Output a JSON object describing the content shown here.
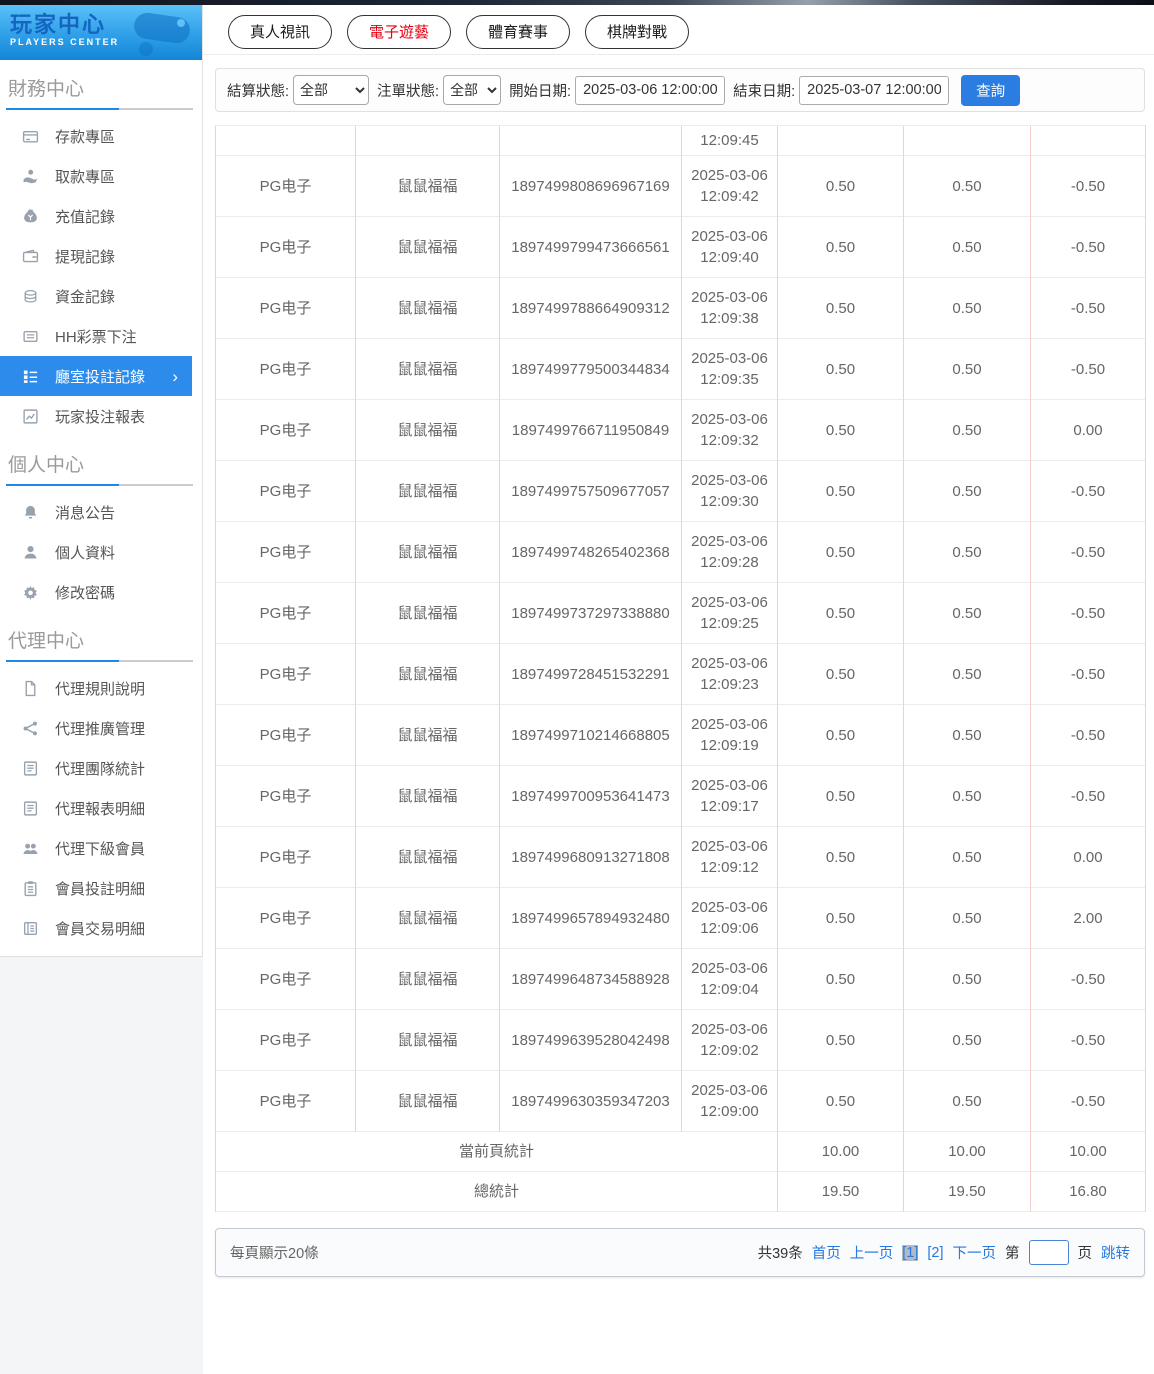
{
  "logo": {
    "title": "玩家中心",
    "subtitle": "PLAYERS  CENTER"
  },
  "sidebar": {
    "sections": [
      {
        "title": "財務中心",
        "items": [
          {
            "icon": "card",
            "label": "存款專區",
            "active": false
          },
          {
            "icon": "hand",
            "label": "取款專區",
            "active": false
          },
          {
            "icon": "moneybag",
            "label": "充值記錄",
            "active": false
          },
          {
            "icon": "wallet",
            "label": "提現記錄",
            "active": false
          },
          {
            "icon": "coins",
            "label": "資金記錄",
            "active": false
          },
          {
            "icon": "ticket",
            "label": "HH彩票下注",
            "active": false
          },
          {
            "icon": "rooms",
            "label": "廳室投註記錄",
            "active": true
          },
          {
            "icon": "chart",
            "label": "玩家投注報表",
            "active": false
          }
        ]
      },
      {
        "title": "個人中心",
        "items": [
          {
            "icon": "bell",
            "label": "消息公告",
            "active": false
          },
          {
            "icon": "user",
            "label": "個人資料",
            "active": false
          },
          {
            "icon": "gear",
            "label": "修改密碼",
            "active": false
          }
        ]
      },
      {
        "title": "代理中心",
        "items": [
          {
            "icon": "doc",
            "label": "代理規則說明",
            "active": false
          },
          {
            "icon": "share",
            "label": "代理推廣管理",
            "active": false
          },
          {
            "icon": "report",
            "label": "代理團隊統計",
            "active": false
          },
          {
            "icon": "report",
            "label": "代理報表明細",
            "active": false
          },
          {
            "icon": "users",
            "label": "代理下級會員",
            "active": false
          },
          {
            "icon": "clipboard",
            "label": "會員投註明細",
            "active": false
          },
          {
            "icon": "translist",
            "label": "會員交易明細",
            "active": false
          }
        ]
      }
    ]
  },
  "tabs": [
    {
      "label": "真人視訊",
      "active": false
    },
    {
      "label": "電子遊藝",
      "active": true
    },
    {
      "label": "體育賽事",
      "active": false
    },
    {
      "label": "棋牌對戰",
      "active": false
    }
  ],
  "filters": {
    "settle_label": "結算狀態:",
    "settle_value": "全部",
    "order_label": "注單狀態:",
    "order_value": "全部",
    "start_label": "開始日期:",
    "start_value": "2025-03-06 12:00:00",
    "end_label": "結束日期:",
    "end_value": "2025-03-07 12:00:00",
    "search_label": "查詢"
  },
  "table": {
    "partial_row_time": "12:09:45",
    "rows": [
      {
        "provider": "PG电子",
        "game": "鼠鼠福福",
        "order_id": "1897499808696967169",
        "date": "2025-03-06",
        "time": "12:09:42",
        "bet": "0.50",
        "valid_bet": "0.50",
        "profit": "-0.50"
      },
      {
        "provider": "PG电子",
        "game": "鼠鼠福福",
        "order_id": "1897499799473666561",
        "date": "2025-03-06",
        "time": "12:09:40",
        "bet": "0.50",
        "valid_bet": "0.50",
        "profit": "-0.50"
      },
      {
        "provider": "PG电子",
        "game": "鼠鼠福福",
        "order_id": "1897499788664909312",
        "date": "2025-03-06",
        "time": "12:09:38",
        "bet": "0.50",
        "valid_bet": "0.50",
        "profit": "-0.50"
      },
      {
        "provider": "PG电子",
        "game": "鼠鼠福福",
        "order_id": "1897499779500344834",
        "date": "2025-03-06",
        "time": "12:09:35",
        "bet": "0.50",
        "valid_bet": "0.50",
        "profit": "-0.50"
      },
      {
        "provider": "PG电子",
        "game": "鼠鼠福福",
        "order_id": "1897499766711950849",
        "date": "2025-03-06",
        "time": "12:09:32",
        "bet": "0.50",
        "valid_bet": "0.50",
        "profit": "0.00"
      },
      {
        "provider": "PG电子",
        "game": "鼠鼠福福",
        "order_id": "1897499757509677057",
        "date": "2025-03-06",
        "time": "12:09:30",
        "bet": "0.50",
        "valid_bet": "0.50",
        "profit": "-0.50"
      },
      {
        "provider": "PG电子",
        "game": "鼠鼠福福",
        "order_id": "1897499748265402368",
        "date": "2025-03-06",
        "time": "12:09:28",
        "bet": "0.50",
        "valid_bet": "0.50",
        "profit": "-0.50"
      },
      {
        "provider": "PG电子",
        "game": "鼠鼠福福",
        "order_id": "1897499737297338880",
        "date": "2025-03-06",
        "time": "12:09:25",
        "bet": "0.50",
        "valid_bet": "0.50",
        "profit": "-0.50"
      },
      {
        "provider": "PG电子",
        "game": "鼠鼠福福",
        "order_id": "1897499728451532291",
        "date": "2025-03-06",
        "time": "12:09:23",
        "bet": "0.50",
        "valid_bet": "0.50",
        "profit": "-0.50"
      },
      {
        "provider": "PG电子",
        "game": "鼠鼠福福",
        "order_id": "1897499710214668805",
        "date": "2025-03-06",
        "time": "12:09:19",
        "bet": "0.50",
        "valid_bet": "0.50",
        "profit": "-0.50"
      },
      {
        "provider": "PG电子",
        "game": "鼠鼠福福",
        "order_id": "1897499700953641473",
        "date": "2025-03-06",
        "time": "12:09:17",
        "bet": "0.50",
        "valid_bet": "0.50",
        "profit": "-0.50"
      },
      {
        "provider": "PG电子",
        "game": "鼠鼠福福",
        "order_id": "1897499680913271808",
        "date": "2025-03-06",
        "time": "12:09:12",
        "bet": "0.50",
        "valid_bet": "0.50",
        "profit": "0.00"
      },
      {
        "provider": "PG电子",
        "game": "鼠鼠福福",
        "order_id": "1897499657894932480",
        "date": "2025-03-06",
        "time": "12:09:06",
        "bet": "0.50",
        "valid_bet": "0.50",
        "profit": "2.00"
      },
      {
        "provider": "PG电子",
        "game": "鼠鼠福福",
        "order_id": "1897499648734588928",
        "date": "2025-03-06",
        "time": "12:09:04",
        "bet": "0.50",
        "valid_bet": "0.50",
        "profit": "-0.50"
      },
      {
        "provider": "PG电子",
        "game": "鼠鼠福福",
        "order_id": "1897499639528042498",
        "date": "2025-03-06",
        "time": "12:09:02",
        "bet": "0.50",
        "valid_bet": "0.50",
        "profit": "-0.50"
      },
      {
        "provider": "PG电子",
        "game": "鼠鼠福福",
        "order_id": "1897499630359347203",
        "date": "2025-03-06",
        "time": "12:09:00",
        "bet": "0.50",
        "valid_bet": "0.50",
        "profit": "-0.50"
      }
    ],
    "summary": [
      {
        "label": "當前頁統計",
        "values": [
          "10.00",
          "10.00",
          "10.00"
        ]
      },
      {
        "label": "總統計",
        "values": [
          "19.50",
          "19.50",
          "16.80"
        ]
      }
    ]
  },
  "pagination": {
    "page_size_text": "每頁顯示20條",
    "total_text": "共39条",
    "first_label": "首页",
    "prev_label": "上一页",
    "pages": [
      {
        "label": "[1]",
        "current": true
      },
      {
        "label": "[2]",
        "current": false
      }
    ],
    "next_label": "下一页",
    "jump_prefix": "第",
    "jump_suffix": "页",
    "jump_action": "跳转",
    "jump_value": ""
  },
  "colors": {
    "accent_blue": "#2d8ceb",
    "link_blue": "#2779e0",
    "button_blue": "#2b7de2",
    "active_tab_red": "#e60012",
    "table_v_border": "#f3cfcf",
    "table_h_border": "#ececec",
    "header_gradient_top": "#5ac1f8",
    "header_gradient_bottom": "#1486d6"
  }
}
